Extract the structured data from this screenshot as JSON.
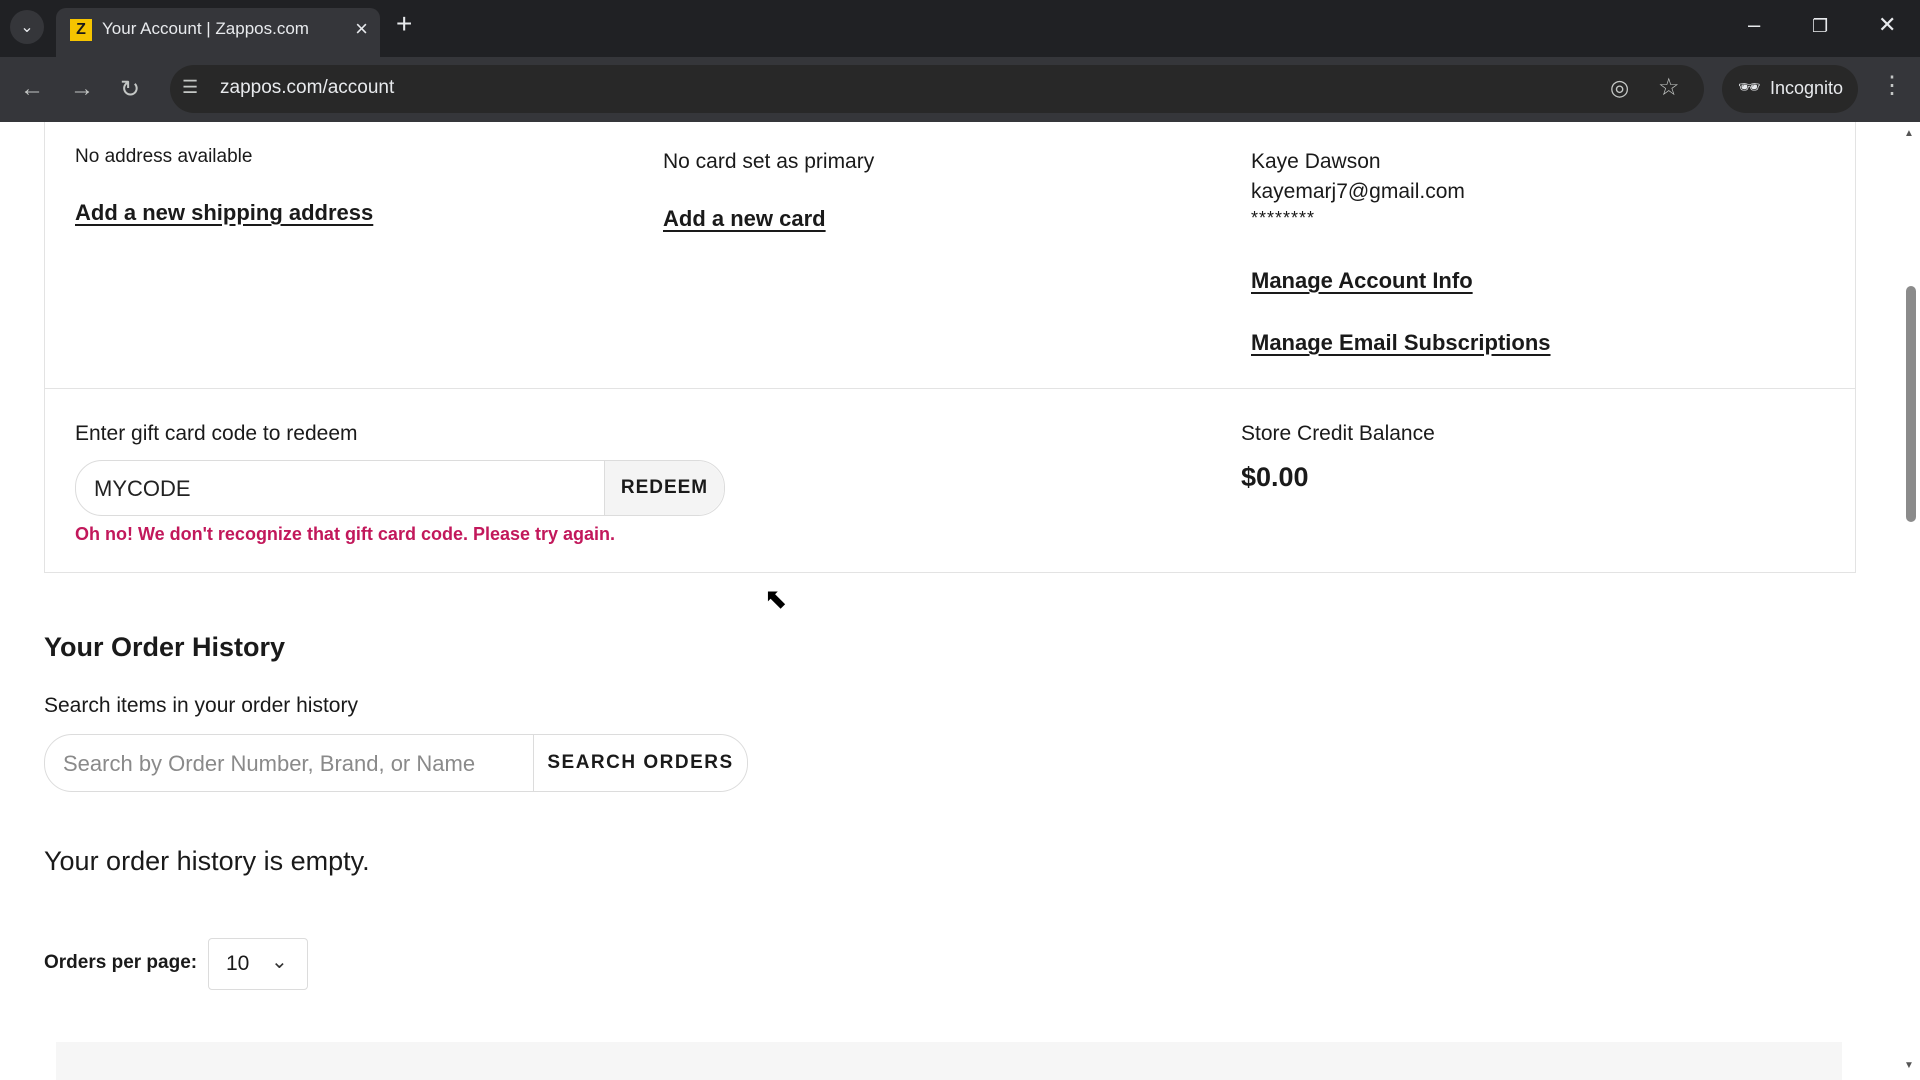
{
  "browser": {
    "tab_title": "Your Account | Zappos.com",
    "favicon_letter": "Z",
    "url": "zappos.com/account",
    "incognito_label": "Incognito"
  },
  "shipping": {
    "status": "No address available",
    "add_link": "Add a new shipping address"
  },
  "payment": {
    "status": "No card set as primary",
    "add_link": "Add a new card"
  },
  "account": {
    "name": "Kaye Dawson",
    "email": "kayemarj7@gmail.com",
    "password_mask": "********",
    "manage_info_link": "Manage Account Info",
    "manage_email_link": "Manage Email Subscriptions"
  },
  "gift_card": {
    "label": "Enter gift card code to redeem",
    "value": "MYCODE",
    "button": "REDEEM",
    "error": "Oh no! We don't recognize that gift card code. Please try again."
  },
  "store_credit": {
    "label": "Store Credit Balance",
    "amount": "$0.00"
  },
  "order_history": {
    "title": "Your Order History",
    "search_label": "Search items in your order history",
    "search_placeholder": "Search by Order Number, Brand, or Name",
    "search_button": "SEARCH ORDERS",
    "empty_message": "Your order history is empty.",
    "per_page_label": "Orders per page:",
    "per_page_value": "10"
  }
}
